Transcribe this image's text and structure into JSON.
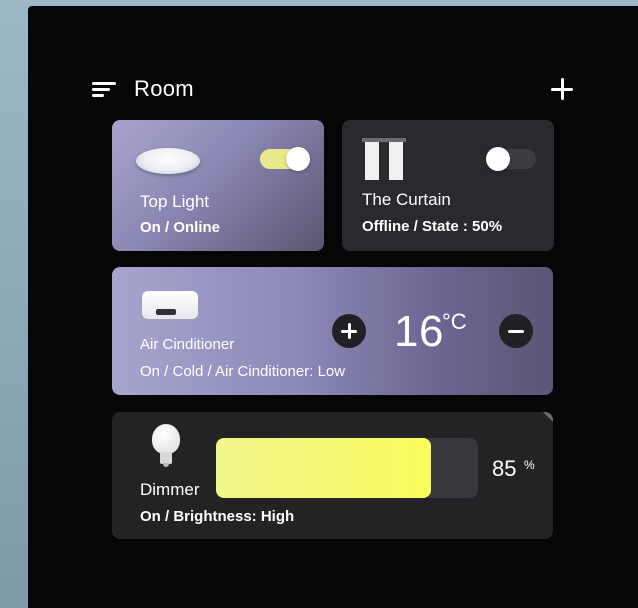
{
  "header": {
    "menu_icon": "menu-icon",
    "title": "Room",
    "add_icon": "plus-icon"
  },
  "devices": {
    "light": {
      "name": "Top Light",
      "status": "On / Online",
      "toggle_on": true,
      "icon": "ceiling-lamp-icon"
    },
    "curtain": {
      "name": "The Curtain",
      "status": "Offline / State : 50%",
      "toggle_on": false,
      "icon": "curtain-icon"
    },
    "ac": {
      "name": "Air Cinditioner",
      "status": "On / Cold / Air Cinditioner: Low",
      "temperature": "16",
      "unit": "°C",
      "icon": "heater-icon"
    },
    "dimmer": {
      "name": "Dimmer",
      "status": "On / Brightness: High",
      "brightness": "85",
      "unit": "%",
      "brightness_fraction": 0.82,
      "icon": "bulb-icon"
    }
  },
  "colors": {
    "toggle_on": "#e9e88a",
    "brightness_fill": "#f5f87a",
    "card_accent": "#8f8ab8"
  }
}
